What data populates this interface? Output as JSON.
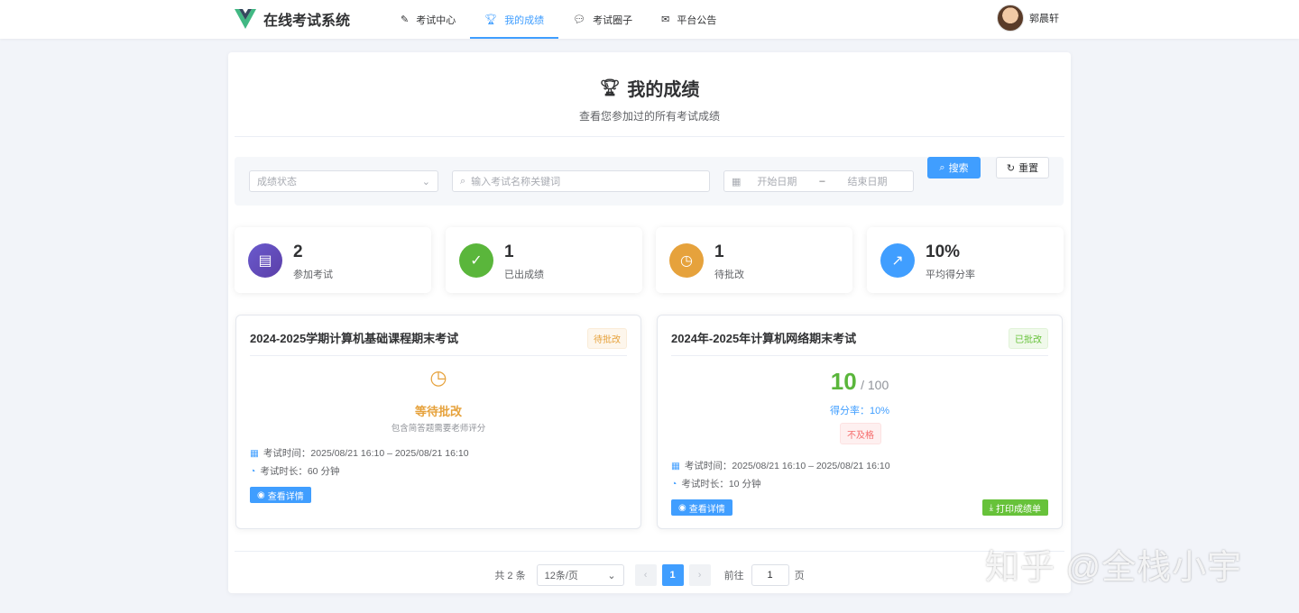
{
  "header": {
    "app_title": "在线考试系统",
    "nav": [
      {
        "label": "考试中心",
        "icon": "pen-icon"
      },
      {
        "label": "我的成绩",
        "icon": "trophy-icon",
        "active": true
      },
      {
        "label": "考试圈子",
        "icon": "chat-icon"
      },
      {
        "label": "平台公告",
        "icon": "mail-icon"
      }
    ],
    "user_name": "郭晨轩"
  },
  "page": {
    "title": "我的成绩",
    "subtitle": "查看您参加过的所有考试成绩"
  },
  "filter": {
    "status_placeholder": "成绩状态",
    "keyword_placeholder": "输入考试名称关键词",
    "start_placeholder": "开始日期",
    "separator": "–",
    "end_placeholder": "结束日期",
    "search_label": "搜索",
    "reset_label": "重置"
  },
  "stats": [
    {
      "value": "2",
      "label": "参加考试",
      "color": "#6a4fc8"
    },
    {
      "value": "1",
      "label": "已出成绩",
      "color": "#5ab63b"
    },
    {
      "value": "1",
      "label": "待批改",
      "color": "#e6a23c"
    },
    {
      "value": "10%",
      "label": "平均得分率",
      "color": "#409eff"
    }
  ],
  "exams": [
    {
      "title": "2024-2025学期计算机基础课程期末考试",
      "status": "待批改",
      "pending_title": "等待批改",
      "pending_desc": "包含简答题需要老师评分",
      "time_label": "考试时间：",
      "time": "2025/08/21 16:10 – 2025/08/21 16:10",
      "duration_label": "考试时长：",
      "duration": "60 分钟",
      "detail_label": "查看详情"
    },
    {
      "title": "2024年-2025年计算机网络期末考试",
      "status": "已批改",
      "score": "10",
      "total": "/ 100",
      "rate": "得分率：10%",
      "result": "不及格",
      "time_label": "考试时间：",
      "time": "2025/08/21 16:10 – 2025/08/21 16:10",
      "duration_label": "考试时长：",
      "duration": "10 分钟",
      "detail_label": "查看详情",
      "print_label": "打印成绩单"
    }
  ],
  "pagination": {
    "total": "共 2 条",
    "page_size": "12条/页",
    "current": "1",
    "goto_label": "前往",
    "goto_value": "1",
    "page_suffix": "页"
  },
  "watermark": "知乎 @全栈小宇"
}
